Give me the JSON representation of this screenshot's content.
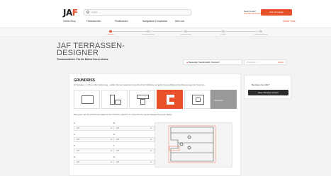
{
  "header": {
    "logo_main": "JA",
    "logo_accent": "F",
    "search_placeholder": "Suche",
    "nav": [
      "Online-Shop",
      "Firmenkunden",
      "Privatkunden",
      "Navigations & Inspiration",
      "Über uns"
    ],
    "account": {
      "line1": "Neuer Kunde?",
      "line2": "Jetzt Benutzerkonto erstellen"
    },
    "cta": "Jetzt anmelden",
    "online_tools": "Online Tools"
  },
  "steps": [
    "Grundriss",
    "Unterkonstruktion",
    "Terrassenbelag",
    "Zubehör",
    "Zusammenfassung"
  ],
  "page": {
    "title_line1": "JAF TERRASSEN-",
    "title_line2": "DESIGNER",
    "subtitle": "Terrassendielen. Für die Bühne Ihres Lebens.",
    "location_select": "Bauseitiger Standortwahl, Österreich",
    "zip_placeholder": "Postleitzahl",
    "zip_action": "Ändern"
  },
  "grundriss": {
    "heading": "GRUNDRISS",
    "description": "Ihr Terrassen, 1, 2 Form oder Freiformung – wählen Sie den passenden Grundriss Ihrer Profilleiste und geben Sie anschließend die Abmessungen der Seiten ein.",
    "shapes": [
      "rectangle",
      "l-shape",
      "t-shape",
      "u-shape",
      "frame"
    ],
    "custom_label": "Sonderform",
    "info": "Bitte geben Sie die gewünschten Maße für Ihre Terrasse in Metern an und bestimmen Sie die Verlegerichtung der Dielen.",
    "fields": [
      {
        "label": "A",
        "value": "100",
        "unit": "m"
      },
      {
        "label": "B",
        "value": "100",
        "unit": "m"
      },
      {
        "label": "C",
        "value": "100",
        "unit": "m"
      },
      {
        "label": "D",
        "value": "100",
        "unit": "m"
      },
      {
        "label": "E",
        "value": "100",
        "unit": "m"
      },
      {
        "label": "F",
        "value": "100",
        "unit": "m"
      },
      {
        "label": "G",
        "value": "100",
        "unit": "m"
      },
      {
        "label": "H",
        "value": "100",
        "unit": "m"
      }
    ]
  },
  "sidebar": {
    "question": "Benötigen Sie Hilfe?",
    "cta": "Neue Terrasse anlegen"
  }
}
